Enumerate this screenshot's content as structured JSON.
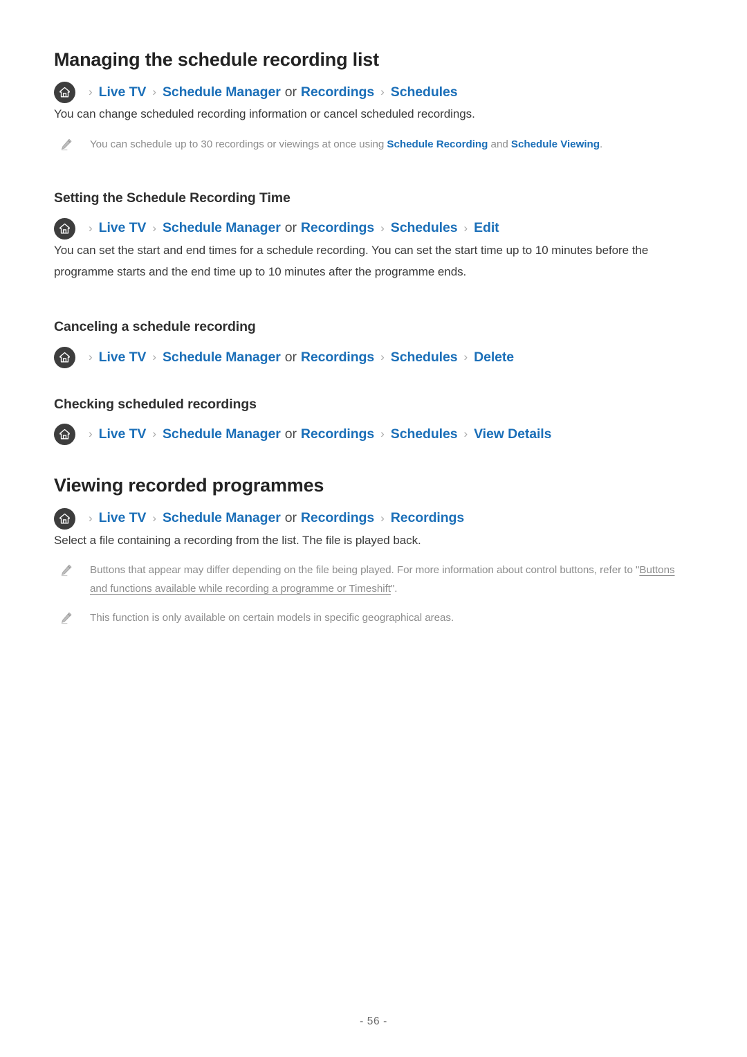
{
  "page": {
    "footer_label": "- 56 -",
    "page_number": 56,
    "link_color": "#1b6fb8",
    "text_color": "#3a3a3a",
    "note_color": "#8c8c8c",
    "home_icon_bg": "#3d3d3d"
  },
  "icons": {
    "home": "home-icon",
    "pencil": "pencil-icon",
    "chevron": "chevron-right-icon"
  },
  "sections": [
    {
      "title": "Managing the schedule recording list",
      "breadcrumb": {
        "home": "home-icon",
        "items": [
          "Live TV",
          "Schedule Manager",
          "Recordings",
          "Schedules"
        ],
        "conjunction": "or",
        "separator": "›"
      },
      "body": "You can change scheduled recording information or cancel scheduled recordings.",
      "notes": [
        {
          "prefix": "You can schedule up to 30 recordings or viewings at once using ",
          "link1": "Schedule Recording",
          "middle": " and ",
          "link2": "Schedule Viewing",
          "suffix": "."
        }
      ]
    },
    {
      "title": "Setting the Schedule Recording Time",
      "breadcrumb": {
        "home": "home-icon",
        "items": [
          "Live TV",
          "Schedule Manager",
          "Recordings",
          "Schedules",
          "Edit"
        ],
        "conjunction": "or",
        "separator": "›"
      },
      "body": "You can set the start and end times for a schedule recording. You can set the start time up to 10 minutes before the programme starts and the end time up to 10 minutes after the programme ends."
    },
    {
      "title": "Canceling a schedule recording",
      "breadcrumb": {
        "home": "home-icon",
        "items": [
          "Live TV",
          "Schedule Manager",
          "Recordings",
          "Schedules",
          "Delete"
        ],
        "conjunction": "or",
        "separator": "›"
      }
    },
    {
      "title": "Checking scheduled recordings",
      "breadcrumb": {
        "home": "home-icon",
        "items": [
          "Live TV",
          "Schedule Manager",
          "Recordings",
          "Schedules",
          "View Details"
        ],
        "conjunction": "or",
        "separator": "›"
      }
    },
    {
      "title": "Viewing recorded programmes",
      "breadcrumb": {
        "home": "home-icon",
        "items": [
          "Live TV",
          "Schedule Manager",
          "Recordings",
          "Recordings"
        ],
        "conjunction": "or",
        "separator": "›"
      },
      "body": "Select a file containing a recording from the list. The file is played back.",
      "notes": [
        {
          "prefix": "Buttons that appear may differ depending on the file being played. For more information about control buttons, refer to \"",
          "link_gray": "Buttons and functions available while recording a programme or Timeshift",
          "suffix": "\"."
        },
        {
          "plain": "This function is only available on certain models in specific geographical areas."
        }
      ]
    }
  ]
}
